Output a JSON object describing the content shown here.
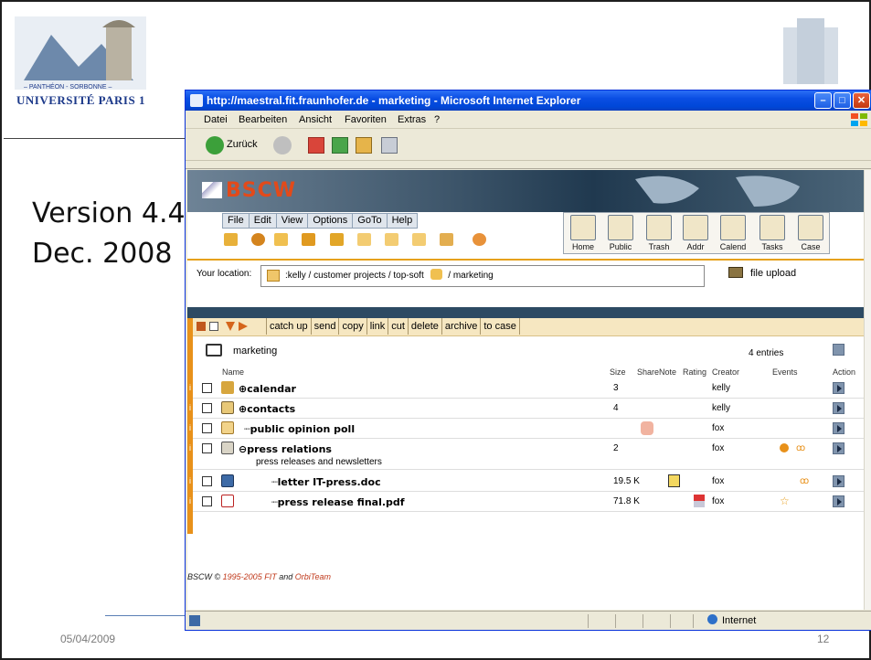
{
  "slide": {
    "version_line1": "Version 4.4",
    "version_line2": "Dec. 2008",
    "footer_date": "05/04/2009",
    "page_number": "12",
    "logo_text_top": "– PANTHÉON - SORBONNE –",
    "logo_text_main": "UNIVERSITÉ PARIS 1"
  },
  "browser": {
    "title": "http://maestral.fit.fraunhofer.de - marketing - Microsoft Internet Explorer",
    "menu": [
      "Datei",
      "Bearbeiten",
      "Ansicht",
      "Favoriten",
      "Extras",
      "?"
    ],
    "back_label": "Zurück",
    "status_zone": "Internet",
    "accent_colors": {
      "titlebar": "#0a4ee3",
      "orange": "#e6a117",
      "dark": "#2d4a63"
    }
  },
  "bscw": {
    "logo": "BSCW",
    "menu": [
      "File",
      "Edit",
      "View",
      "Options",
      "GoTo",
      "Help"
    ],
    "nav_buttons": [
      "Home",
      "Public",
      "Trash",
      "Addr",
      "Calend",
      "Tasks",
      "Case"
    ],
    "location_label": "Your location:",
    "location_path": ":kelly / customer projects / top-soft",
    "location_tail": "/ marketing",
    "file_upload": "file upload",
    "actions": [
      "catch up",
      "send",
      "copy",
      "link",
      "cut",
      "delete",
      "archive",
      "to case"
    ],
    "folder_name": "marketing",
    "entries": "4 entries",
    "columns": {
      "name": "Name",
      "size": "Size",
      "sharenote": "ShareNote",
      "rating": "Rating",
      "creator": "Creator",
      "events": "Events",
      "action": "Action"
    },
    "rows": [
      {
        "name": "calendar",
        "size": "3",
        "creator": "kelly",
        "icon": "calendar-icon"
      },
      {
        "name": "contacts",
        "size": "4",
        "creator": "kelly",
        "icon": "contacts-icon"
      },
      {
        "name": "public opinion poll",
        "size": "",
        "creator": "fox",
        "icon": "poll-icon"
      },
      {
        "name": "press relations",
        "size": "2",
        "creator": "fox",
        "icon": "folder-icon",
        "description": "press releases and newsletters"
      },
      {
        "name": "letter IT-press.doc",
        "size": "19.5 K",
        "creator": "fox",
        "icon": "doc-icon"
      },
      {
        "name": "press release final.pdf",
        "size": "71.8 K",
        "creator": "fox",
        "icon": "pdf-icon"
      }
    ],
    "copyright_prefix": "BSCW ©",
    "copyright_years": "1995-2005",
    "copyright_fit": "FIT",
    "copyright_and": "and",
    "copyright_orbiteam": "OrbiTeam"
  }
}
